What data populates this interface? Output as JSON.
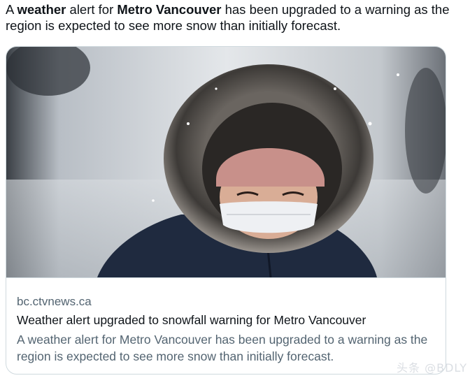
{
  "tweet": {
    "text_part1": "A ",
    "bold1": "weather",
    "text_part2": " alert for ",
    "bold2": "Metro Vancouver",
    "text_part3": " has been upgraded to a warning as the region is expected to see more snow than initially forecast."
  },
  "card": {
    "image_icon": "photo-person-in-fur-hood-snow",
    "domain": "bc.ctvnews.ca",
    "headline": "Weather alert upgraded to snowfall warning for Metro Vancouver",
    "description": "A weather alert for Metro Vancouver has been upgraded to a warning as the region is expected to see more snow than initially forecast."
  },
  "watermark": "头条 @BDLY",
  "colors": {
    "border": "#cfd9de",
    "secondary_text": "#536471",
    "primary_text": "#0f1419"
  }
}
